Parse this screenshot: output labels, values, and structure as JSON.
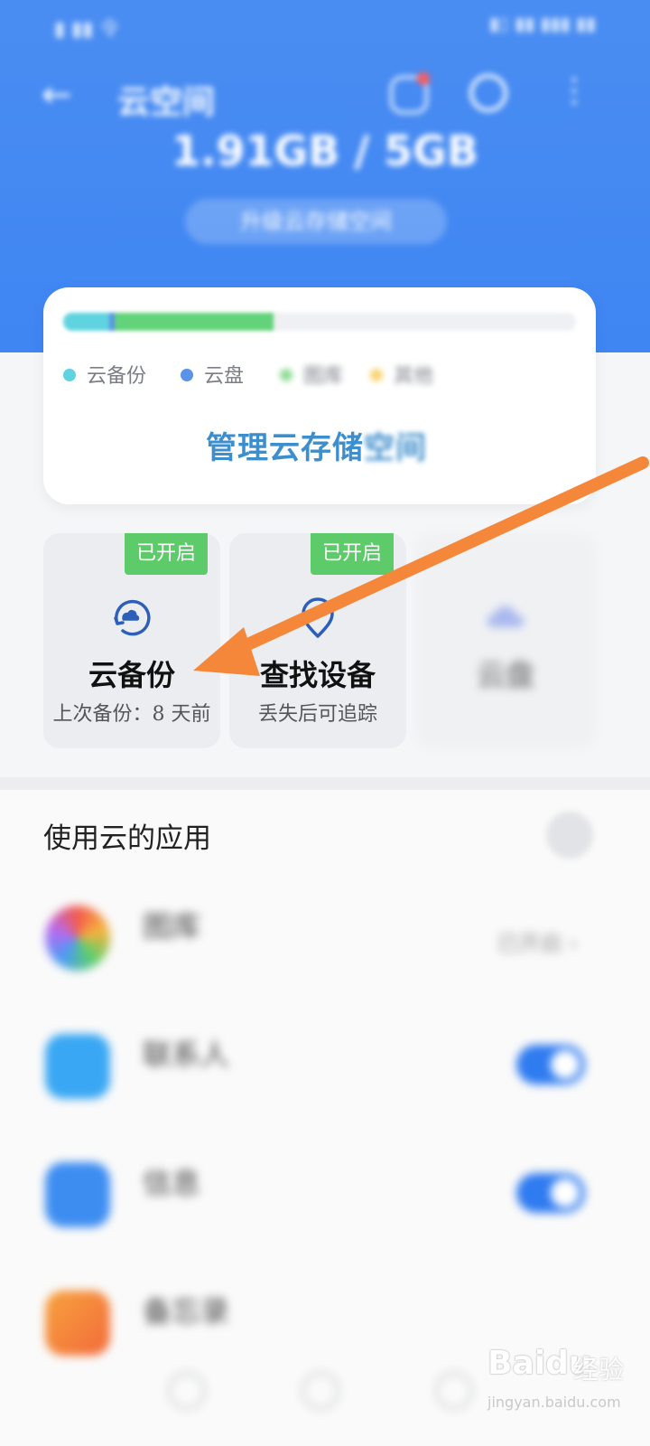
{
  "status_bar": {
    "left": "▮ ▮▮ 令",
    "right": "▮▯ ▮▮ ▮▮▮ ▮▮"
  },
  "nav": {
    "back_glyph": "←",
    "title": "云空间",
    "subtitle": "",
    "more_glyph": "⋮"
  },
  "storage": {
    "used_text": "1.91GB / 5GB",
    "upgrade_label": "升级云存储空间"
  },
  "storage_card": {
    "segments": [
      {
        "name": "云备份",
        "fraction": 0.09,
        "color": "#5fd3df"
      },
      {
        "name": "云盘",
        "fraction": 0.01,
        "color": "#5b93e8"
      },
      {
        "name": "图库",
        "fraction": 0.31,
        "color": "#63d37a"
      }
    ],
    "legend": [
      {
        "label": "云备份",
        "color": "#5fd3df"
      },
      {
        "label": "云盘",
        "color": "#5b93e8"
      },
      {
        "label": "图库",
        "color": "#8fdc95"
      },
      {
        "label": "其他",
        "color": "#f7d36e"
      }
    ],
    "manage_label_clear": "管理云存储",
    "manage_label_blur": "空间"
  },
  "tiles": [
    {
      "badge": "已开启",
      "name": "云备份",
      "desc": "上次备份：8 天前"
    },
    {
      "badge": "已开启",
      "name": "查找设备",
      "desc": "丢失后可追踪"
    },
    {
      "badge": "",
      "name": "云盘",
      "desc": ""
    }
  ],
  "apps_section": {
    "title": "使用云的应用",
    "apps": [
      {
        "name": "图库",
        "subtitle": "",
        "status": "已开启 ›",
        "icon_color": "#f06f5b",
        "toggle": false
      },
      {
        "name": "联系人",
        "subtitle": "",
        "status": "",
        "icon_color": "#39a7f3",
        "toggle": true
      },
      {
        "name": "信息",
        "subtitle": "",
        "status": "",
        "icon_color": "#3d8df1",
        "toggle": true
      },
      {
        "name": "备忘录",
        "subtitle": "",
        "status": "",
        "icon_color": "#f58b3a",
        "toggle": false
      }
    ]
  },
  "watermark": {
    "logo": "Baidu",
    "suffix": "经验",
    "url": "jingyan.baidu.com"
  },
  "colors": {
    "header_blue": "#3f86f3",
    "badge_green": "#5ecb6a",
    "arrow_orange": "#f5873a",
    "link_blue": "#3d8ecd"
  }
}
